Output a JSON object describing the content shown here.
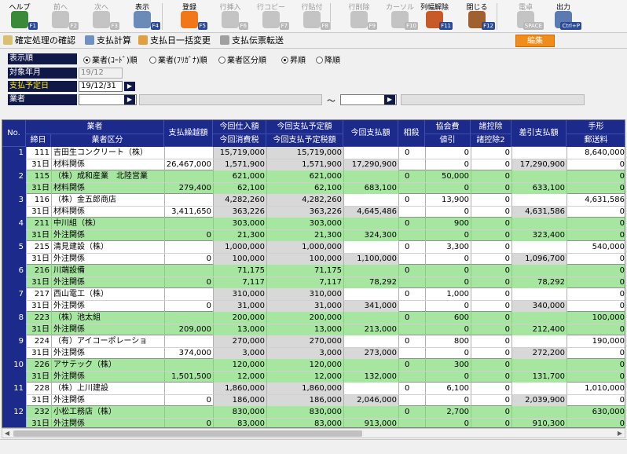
{
  "toolbar": {
    "buttons": [
      {
        "label": "ヘルプ",
        "fkey": "F1",
        "icon": "help-icon",
        "enabled": true,
        "color": "#3a8a3a"
      },
      {
        "label": "前へ",
        "fkey": "F2",
        "icon": "arrow-left-icon",
        "enabled": false,
        "color": "#c4c4c4"
      },
      {
        "label": "次へ",
        "fkey": "F3",
        "icon": "arrow-right-icon",
        "enabled": false,
        "color": "#c4c4c4"
      },
      {
        "label": "表示",
        "fkey": "F4",
        "icon": "magnifier-icon",
        "enabled": true,
        "color": "#6a8ab8"
      },
      {
        "label": "登録",
        "fkey": "F5",
        "icon": "ok-icon",
        "enabled": true,
        "color": "#f07818"
      },
      {
        "label": "行挿入",
        "fkey": "F6",
        "icon": "row-insert-icon",
        "enabled": false,
        "color": "#c4c4c4"
      },
      {
        "label": "行コピー",
        "fkey": "F7",
        "icon": "row-copy-icon",
        "enabled": false,
        "color": "#c4c4c4"
      },
      {
        "label": "行貼付",
        "fkey": "F8",
        "icon": "row-paste-icon",
        "enabled": false,
        "color": "#c4c4c4"
      },
      {
        "label": "行削除",
        "fkey": "F9",
        "icon": "row-delete-icon",
        "enabled": false,
        "color": "#c4c4c4"
      },
      {
        "label": "カーソル",
        "fkey": "F10",
        "icon": "cursor-icon",
        "enabled": false,
        "color": "#c4c4c4"
      },
      {
        "label": "列幅解除",
        "fkey": "F11",
        "icon": "column-width-icon",
        "enabled": true,
        "color": "#c85a2a"
      },
      {
        "label": "閉じる",
        "fkey": "F12",
        "icon": "close-door-icon",
        "enabled": true,
        "color": "#a06030"
      },
      {
        "label": "電卓",
        "fkey": "SPACE",
        "icon": "calculator-icon",
        "enabled": false,
        "color": "#c4c4c4"
      },
      {
        "label": "出力",
        "fkey": "Ctrl+P",
        "icon": "printer-icon",
        "enabled": true,
        "color": "#5a7ab0"
      }
    ]
  },
  "actions": {
    "items": [
      {
        "label": "確定処理の確認",
        "icon": "confirm-icon"
      },
      {
        "label": "支払計算",
        "icon": "calc-icon"
      },
      {
        "label": "支払日一括変更",
        "icon": "person-icon"
      },
      {
        "label": "支払伝票転送",
        "icon": "transfer-icon"
      }
    ],
    "edit_label": "編集"
  },
  "form": {
    "display_order_label": "表示順",
    "order_options": [
      "業者(ｺｰﾄﾞ)順",
      "業者(ﾌﾘｶﾞﾅ)順",
      "業者区分順",
      "昇順",
      "降順"
    ],
    "target_month_label": "対象年月",
    "target_month_value": "19/12",
    "pay_date_label": "支払予定日",
    "pay_date_value": "19/12/31",
    "vendor_label": "業者",
    "range_sep": "～"
  },
  "grid": {
    "headers": {
      "no": "No.",
      "vendor": "業者",
      "close_day": "締日",
      "vendor_class": "業者区分",
      "carry": "支払繰越額",
      "purchase": "今回仕入額",
      "tax": "今回消費税",
      "planned": "今回支払予定額",
      "planned_tax": "今回支払予定税額",
      "paid": "今回支払額",
      "offset": "相殺",
      "assoc_fee": "協会費",
      "discount": "値引",
      "deduct": "諸控除",
      "deduct2": "諸控除2",
      "net": "差引支払額",
      "bill": "手形",
      "postage": "郵送料"
    },
    "rows": [
      {
        "no": "1",
        "code": "111",
        "name": "吉田生コンクリート（株）",
        "day": "31日",
        "cls": "材料関係",
        "carry": "26,467,000",
        "pur": "15,719,000",
        "tax": "1,571,900",
        "plan": "15,719,000",
        "ptax": "1,571,900",
        "paid": "17,290,900",
        "off": "0",
        "fee": "0",
        "disc": "0",
        "ded": "0",
        "ded2": "0",
        "net": "17,290,900",
        "bill": "8,640,000",
        "post": "0",
        "green": false
      },
      {
        "no": "2",
        "code": "115",
        "name": "（株）成和産業　北陸営業",
        "day": "31日",
        "cls": "材料関係",
        "carry": "279,400",
        "pur": "621,000",
        "tax": "62,100",
        "plan": "621,000",
        "ptax": "62,100",
        "paid": "683,100",
        "off": "0",
        "fee": "50,000",
        "disc": "0",
        "ded": "0",
        "ded2": "0",
        "net": "633,100",
        "bill": "0",
        "post": "0",
        "green": true
      },
      {
        "no": "3",
        "code": "116",
        "name": "（株）金五郎商店",
        "day": "31日",
        "cls": "材料関係",
        "carry": "3,411,650",
        "pur": "4,282,260",
        "tax": "363,226",
        "plan": "4,282,260",
        "ptax": "363,226",
        "paid": "4,645,486",
        "off": "0",
        "fee": "13,900",
        "disc": "0",
        "ded": "0",
        "ded2": "0",
        "net": "4,631,586",
        "bill": "4,631,586",
        "post": "0",
        "green": false
      },
      {
        "no": "4",
        "code": "211",
        "name": "中川組（株）",
        "day": "31日",
        "cls": "外注関係",
        "carry": "0",
        "pur": "303,000",
        "tax": "21,300",
        "plan": "303,000",
        "ptax": "21,300",
        "paid": "324,300",
        "off": "0",
        "fee": "900",
        "disc": "0",
        "ded": "0",
        "ded2": "0",
        "net": "323,400",
        "bill": "0",
        "post": "0",
        "green": true
      },
      {
        "no": "5",
        "code": "215",
        "name": "清見建設（株）",
        "day": "31日",
        "cls": "外注関係",
        "carry": "0",
        "pur": "1,000,000",
        "tax": "100,000",
        "plan": "1,000,000",
        "ptax": "100,000",
        "paid": "1,100,000",
        "off": "0",
        "fee": "3,300",
        "disc": "0",
        "ded": "0",
        "ded2": "0",
        "net": "1,096,700",
        "bill": "540,000",
        "post": "0",
        "green": false
      },
      {
        "no": "6",
        "code": "216",
        "name": "川端設備",
        "day": "31日",
        "cls": "外注関係",
        "carry": "0",
        "pur": "71,175",
        "tax": "7,117",
        "plan": "71,175",
        "ptax": "7,117",
        "paid": "78,292",
        "off": "0",
        "fee": "0",
        "disc": "0",
        "ded": "0",
        "ded2": "0",
        "net": "78,292",
        "bill": "0",
        "post": "0",
        "green": true
      },
      {
        "no": "7",
        "code": "217",
        "name": "西山電工（株）",
        "day": "31日",
        "cls": "外注関係",
        "carry": "0",
        "pur": "310,000",
        "tax": "31,000",
        "plan": "310,000",
        "ptax": "31,000",
        "paid": "341,000",
        "off": "0",
        "fee": "1,000",
        "disc": "0",
        "ded": "0",
        "ded2": "0",
        "net": "340,000",
        "bill": "0",
        "post": "0",
        "green": false
      },
      {
        "no": "8",
        "code": "223",
        "name": "（株）池太組",
        "day": "31日",
        "cls": "外注関係",
        "carry": "209,000",
        "pur": "200,000",
        "tax": "13,000",
        "plan": "200,000",
        "ptax": "13,000",
        "paid": "213,000",
        "off": "0",
        "fee": "600",
        "disc": "0",
        "ded": "0",
        "ded2": "0",
        "net": "212,400",
        "bill": "100,000",
        "post": "0",
        "green": true
      },
      {
        "no": "9",
        "code": "224",
        "name": "（有）アイコーポレーショ",
        "day": "31日",
        "cls": "外注関係",
        "carry": "374,000",
        "pur": "270,000",
        "tax": "3,000",
        "plan": "270,000",
        "ptax": "3,000",
        "paid": "273,000",
        "off": "0",
        "fee": "800",
        "disc": "0",
        "ded": "0",
        "ded2": "0",
        "net": "272,200",
        "bill": "190,000",
        "post": "0",
        "green": false
      },
      {
        "no": "10",
        "code": "226",
        "name": "アサテック（株）",
        "day": "31日",
        "cls": "外注関係",
        "carry": "1,501,500",
        "pur": "120,000",
        "tax": "12,000",
        "plan": "120,000",
        "ptax": "12,000",
        "paid": "132,000",
        "off": "0",
        "fee": "300",
        "disc": "0",
        "ded": "0",
        "ded2": "0",
        "net": "131,700",
        "bill": "0",
        "post": "0",
        "green": true
      },
      {
        "no": "11",
        "code": "228",
        "name": "（株）上川建設",
        "day": "31日",
        "cls": "外注関係",
        "carry": "0",
        "pur": "1,860,000",
        "tax": "186,000",
        "plan": "1,860,000",
        "ptax": "186,000",
        "paid": "2,046,000",
        "off": "0",
        "fee": "6,100",
        "disc": "0",
        "ded": "0",
        "ded2": "0",
        "net": "2,039,900",
        "bill": "1,010,000",
        "post": "0",
        "green": false
      },
      {
        "no": "12",
        "code": "232",
        "name": "小松工務店（株）",
        "day": "31日",
        "cls": "外注関係",
        "carry": "0",
        "pur": "830,000",
        "tax": "83,000",
        "plan": "830,000",
        "ptax": "83,000",
        "paid": "913,000",
        "off": "0",
        "fee": "2,700",
        "disc": "0",
        "ded": "0",
        "ded2": "0",
        "net": "910,300",
        "bill": "630,000",
        "post": "0",
        "green": true
      }
    ]
  },
  "colors": {
    "header_bg": "#1c2a8c",
    "green_row": "#a6e6a0",
    "gray_cell": "#d8d8d8",
    "edit_button": "#f08c1c"
  }
}
